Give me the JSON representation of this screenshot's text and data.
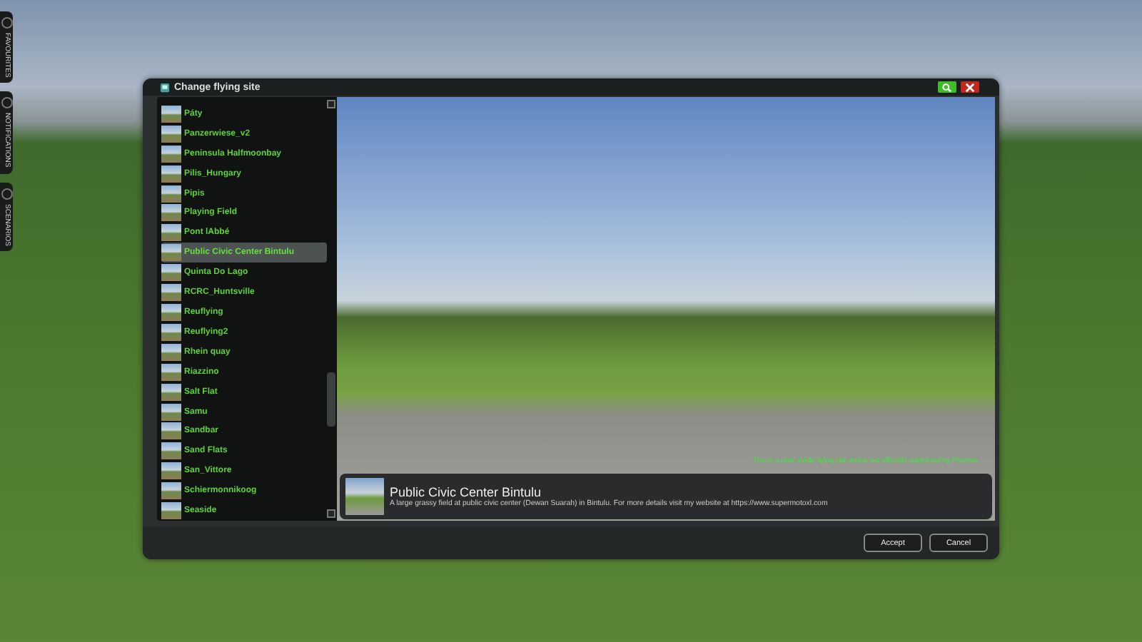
{
  "side_tabs": [
    {
      "label": "FAVOURITES"
    },
    {
      "label": "NOTIFICATIONS"
    },
    {
      "label": "SCENARIOS"
    }
  ],
  "window": {
    "title": "Change flying site"
  },
  "sites": [
    {
      "name": "Páty",
      "selected": false
    },
    {
      "name": "Panzerwiese_v2",
      "selected": false
    },
    {
      "name": "Peninsula Halfmoonbay",
      "selected": false
    },
    {
      "name": "Pilis_Hungary",
      "selected": false
    },
    {
      "name": "Pipis",
      "selected": false
    },
    {
      "name": "Playing Field",
      "selected": false
    },
    {
      "name": "Pont lAbbé",
      "selected": false
    },
    {
      "name": "Public Civic Center Bintulu",
      "selected": true
    },
    {
      "name": "Quinta Do Lago",
      "selected": false
    },
    {
      "name": "RCRC_Huntsville",
      "selected": false
    },
    {
      "name": "Reuflying",
      "selected": false
    },
    {
      "name": "Reuflying2",
      "selected": false
    },
    {
      "name": "Rhein quay",
      "selected": false
    },
    {
      "name": "Riazzino",
      "selected": false
    },
    {
      "name": "Salt Flat",
      "selected": false
    },
    {
      "name": "Samu",
      "selected": false
    },
    {
      "name": "Sandbar",
      "selected": false
    },
    {
      "name": "Sand Flats",
      "selected": false
    },
    {
      "name": "San_Vittore",
      "selected": false
    },
    {
      "name": "Schiermonnikoog",
      "selected": false
    },
    {
      "name": "Seaside",
      "selected": false
    }
  ],
  "preview": {
    "note": "This is a user made flying site and is not officially supported by Phoenix",
    "site_title": "Public Civic Center Bintulu",
    "description": "A large grassy field at public civic center (Dewan Suarah) in Bintulu.  For more details visit my website at https://www.supermotoxl.com"
  },
  "buttons": [
    {
      "label": "Accept"
    },
    {
      "label": "Cancel"
    }
  ]
}
